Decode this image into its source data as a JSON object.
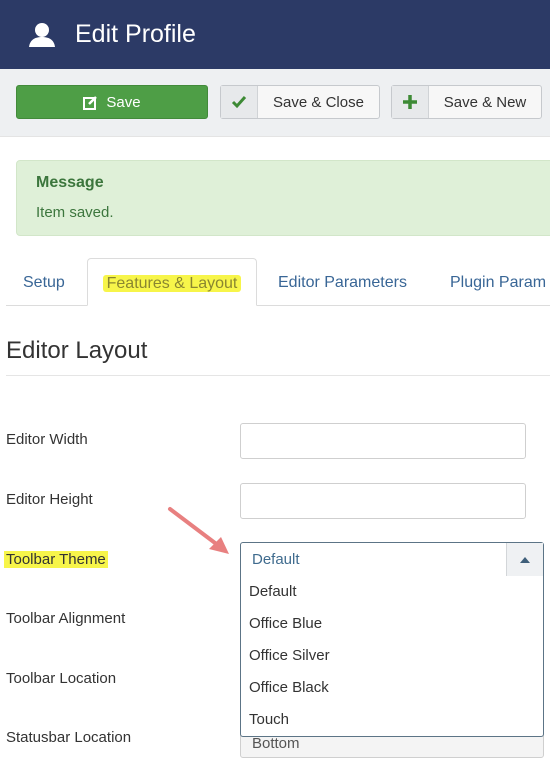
{
  "header": {
    "title": "Edit Profile",
    "icon": "user-icon"
  },
  "toolbar": {
    "save_label": "Save",
    "save_close_label": "Save & Close",
    "save_new_label": "Save & New"
  },
  "alert": {
    "heading": "Message",
    "text": "Item saved."
  },
  "tabs": [
    {
      "label": "Setup"
    },
    {
      "label": "Features & Layout",
      "active": true
    },
    {
      "label": "Editor Parameters"
    },
    {
      "label": "Plugin Param"
    }
  ],
  "section": {
    "title": "Editor Layout"
  },
  "fields": {
    "editor_width": {
      "label": "Editor Width",
      "value": ""
    },
    "editor_height": {
      "label": "Editor Height",
      "value": ""
    },
    "toolbar_theme": {
      "label": "Toolbar Theme",
      "value": "Default",
      "options": [
        "Default",
        "Office Blue",
        "Office Silver",
        "Office Black",
        "Touch"
      ]
    },
    "toolbar_alignment": {
      "label": "Toolbar Alignment"
    },
    "toolbar_location": {
      "label": "Toolbar Location"
    },
    "statusbar_location": {
      "label": "Statusbar Location",
      "value": "Bottom"
    }
  },
  "colors": {
    "header_bg": "#2c3a66",
    "save_green": "#4e9e46",
    "alert_bg": "#dff0d8",
    "highlight": "#f7f54a",
    "annotation_arrow": "#e57373"
  }
}
